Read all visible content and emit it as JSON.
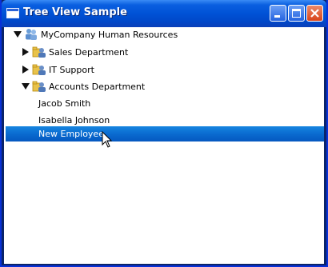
{
  "window": {
    "title": "Tree View Sample"
  },
  "tree": {
    "root": "MyCompany Human Resources",
    "departments": [
      "Sales Department",
      "IT Support",
      "Accounts Department"
    ],
    "employees": [
      "Jacob Smith",
      "Isabella Johnson",
      "New Employee"
    ]
  },
  "colors": {
    "titlebar": "#0052d6",
    "selection": "#0a6bd0",
    "close_button": "#d8441a"
  }
}
